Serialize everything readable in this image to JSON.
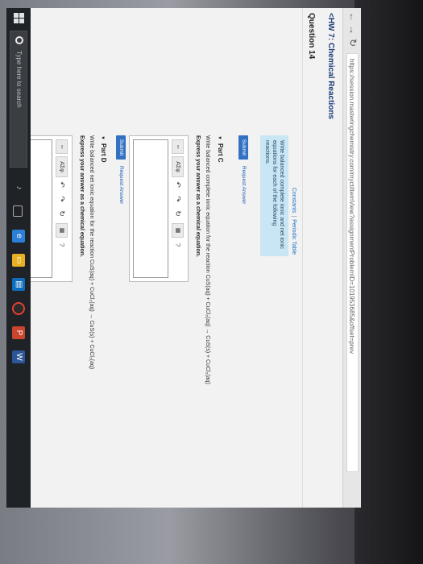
{
  "browser": {
    "url": "https://session.masteringchemistry.com/myct/itemView?assignmentProblemID=101953685&offset=prev"
  },
  "header": {
    "assignment": "<HW 7: Chemical Reactions",
    "question": "Question 14"
  },
  "left_panel": {
    "constants_link": "Constants",
    "periodic_table_link": "Periodic Table",
    "instructions": "Write balanced complete ionic and net ionic equations for each of the following reactions."
  },
  "top_actions": {
    "submit_label": "Submit",
    "request_answer_label": "Request Answer"
  },
  "part_c": {
    "label": "Part C",
    "prompt": "Write balanced complete ionic equation for the reaction CuS(aq) + CuCl₂(aq) → CuS(s) + CuCl₂(aq)",
    "express": "Express your answer as a chemical equation.",
    "submit_label": "Submit",
    "request_answer_label": "Request Answer"
  },
  "part_d": {
    "label": "Part D",
    "prompt": "Write balanced net ionic equation for the reaction CuS(aq) + CuCl₂(aq) → CuS(s) + CuCl₂(aq)",
    "express": "Express your answer as a chemical equation."
  },
  "toolbar": {
    "greek_label": "ΑΣφ",
    "undo_glyph": "↶",
    "redo_glyph": "↷",
    "reset_glyph": "↻",
    "help_glyph": "?"
  },
  "taskbar": {
    "search_placeholder": "Type here to search"
  }
}
